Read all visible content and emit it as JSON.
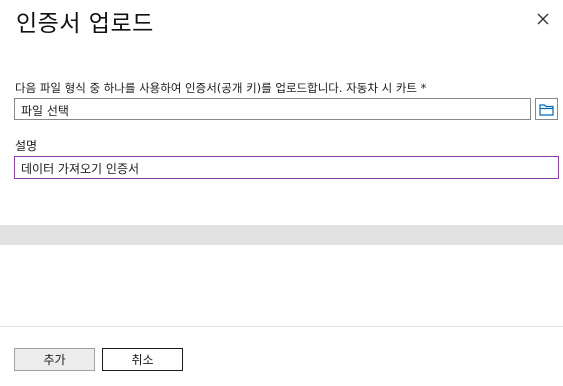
{
  "dialog": {
    "title": "인증서 업로드",
    "close_icon": "close-icon"
  },
  "file_field": {
    "label": "다음 파일 형식 중 하나를 사용하여 인증서(공개 키)를 업로드합니다. 자동차 시 카트 *",
    "value": "파일 선택",
    "browse_icon": "folder-icon"
  },
  "description_field": {
    "label": "설명",
    "value": "데이터 가져오기 인증서"
  },
  "buttons": {
    "add_label": "추가",
    "cancel_label": "취소"
  },
  "colors": {
    "accent_border": "#8d3ea8",
    "browse_icon": "#0067b8",
    "band": "#e1e1e1"
  }
}
